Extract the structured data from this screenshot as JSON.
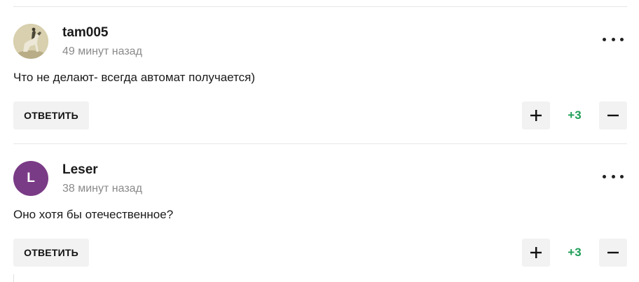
{
  "comments": [
    {
      "author": "tam005",
      "time": "49 минут назад",
      "text": "Что не делают- всегда автомат получается)",
      "reply_label": "Ответить",
      "score": "+3",
      "avatar_type": "photo",
      "avatar_icon": "horse-rider-photo"
    },
    {
      "author": "Leser",
      "time": "38 минут назад",
      "text": "Оно хотя бы отечественное?",
      "reply_label": "Ответить",
      "score": "+3",
      "avatar_type": "letter",
      "avatar_letter": "L",
      "avatar_color": "#7a3b86"
    }
  ],
  "colors": {
    "score_positive": "#1f9e57",
    "button_bg": "#f2f2f2",
    "muted_text": "#8a8a8a"
  },
  "icons": {
    "more": "more-dots-icon",
    "upvote": "plus-icon",
    "downvote": "minus-icon"
  }
}
